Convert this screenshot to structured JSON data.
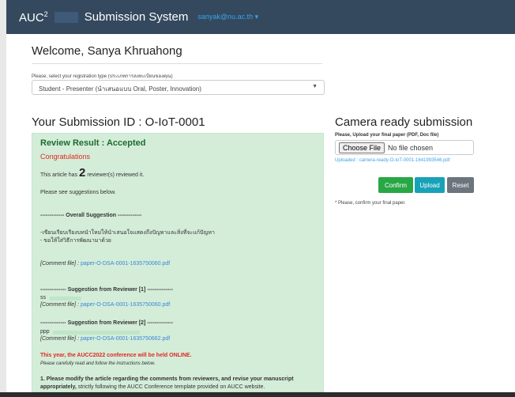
{
  "header": {
    "brand": "AUC",
    "brand_sup": "2",
    "system": "Submission System",
    "user": "sanyak@nu.ac.th ▾"
  },
  "welcome": "Welcome, Sanya Khruahong",
  "registration": {
    "label": "Please, select your registration type (ประเภทการลงทะเบียนของคุณ)",
    "selected": "Student - Presenter (นำเสนอแบบ Oral, Poster, Innovation)"
  },
  "submission_title": "Your Submission ID : O-IoT-0001",
  "review": {
    "title": "Review Result : Accepted",
    "congrats": "Congratulations",
    "count_prefix": "This article has",
    "count": "2",
    "count_suffix": "reviewer(s) reviewed it.",
    "see": "Please see suggestions below.",
    "overall_heading": "------------- Overall Suggestion -------------",
    "overall_line1": "-เขียนเรียบเรียงบทนำใหม่ให้นำเสนอใจแสดงถึงปัญหาและสิ่งที่จะแก้ปัญหา",
    "overall_line2": "- ขอให้ใส่วิธีการพัฒนามาด้วย",
    "comment_label": "[Comment file] :",
    "comment_file1": "paper-O-DSA-0001-1635750060.pdf",
    "rev1_heading": "-------------- Suggestion from Reviewer [1] --------------",
    "rev1_text": "ss",
    "comment_file2": "paper-O-DSA-0001-1635750060.pdf",
    "rev2_heading": "-------------- Suggestion from Reviewer [2] --------------",
    "rev2_text": "ppp",
    "comment_file3": "paper-O-DSA-0001-1635750662.pdf",
    "online": "This year, the AUCC2022 conference will be held ONLINE.",
    "instructions": "Please carefully read and follow the instructions below.",
    "step1_bold": "1. Please modify the article regarding the comments from reviewers, and revise your manuscript",
    "step1_bold2": "appropriately,",
    "step1_rest": "strictly following the AUCC Conference template provided on AUCC website."
  },
  "camera": {
    "title": "Camera ready submission",
    "label": "Please, Upload your final paper (PDF, Doc file)",
    "choose_btn": "Choose File",
    "no_file": "No file chosen",
    "uploaded": "Uploaded : camera-ready-O-IoT-0001-1641993546.pdf",
    "confirm": "Confirm",
    "upload": "Upload",
    "reset": "Reset",
    "note": "* Please, confirm your final paper."
  },
  "colors": {
    "header": "#34495e",
    "review_bg": "#d4edd9",
    "accepted": "#1e6b30",
    "red": "#e0281f",
    "link": "#3a87d8",
    "confirm": "#28a745",
    "upload": "#17a2b8",
    "reset": "#6c757d"
  }
}
